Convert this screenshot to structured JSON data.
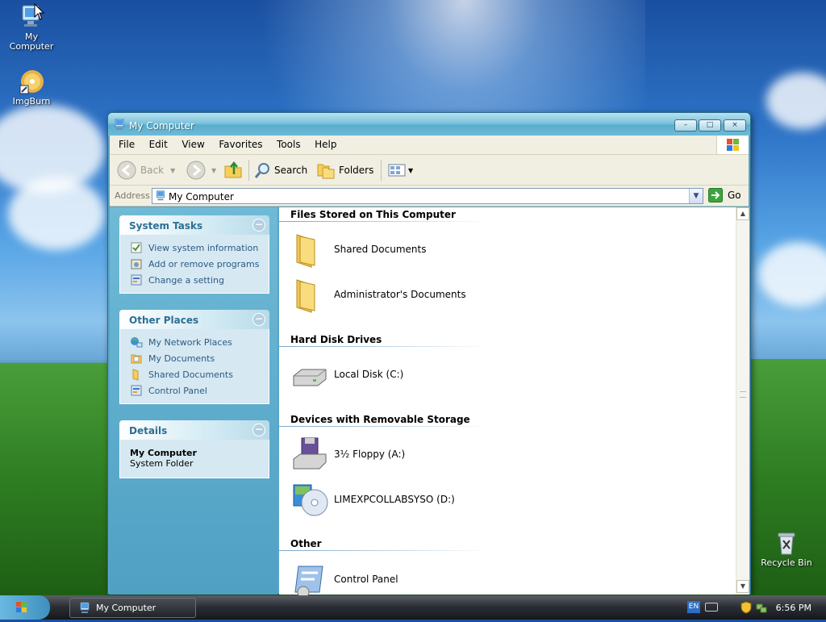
{
  "desktop": {
    "icons": [
      {
        "label": "My\nComputer"
      },
      {
        "label": "ImgBurn"
      },
      {
        "label": "Recycle Bin"
      }
    ]
  },
  "window": {
    "title": "My Computer",
    "buttons": {
      "minimize": "–",
      "maximize": "□",
      "close": "×"
    },
    "menu": [
      "File",
      "Edit",
      "View",
      "Favorites",
      "Tools",
      "Help"
    ],
    "toolbar": {
      "back": "Back",
      "search": "Search",
      "folders": "Folders"
    },
    "address": {
      "label": "Address",
      "value": "My Computer",
      "go": "Go"
    }
  },
  "left_pane": {
    "system_tasks": {
      "title": "System Tasks",
      "items": [
        "View system information",
        "Add or remove programs",
        "Change a setting"
      ]
    },
    "other_places": {
      "title": "Other Places",
      "items": [
        "My Network Places",
        "My Documents",
        "Shared Documents",
        "Control Panel"
      ]
    },
    "details": {
      "title": "Details",
      "name": "My Computer",
      "type": "System Folder"
    }
  },
  "right_pane": {
    "groups": [
      {
        "title": "Files Stored on This Computer",
        "items": [
          "Shared Documents",
          "Administrator's Documents"
        ]
      },
      {
        "title": "Hard Disk Drives",
        "items": [
          "Local Disk (C:)"
        ]
      },
      {
        "title": "Devices with Removable Storage",
        "items": [
          "3½ Floppy (A:)",
          "LIMEXPCOLLABSYSO (D:)"
        ]
      },
      {
        "title": "Other",
        "items": [
          "Control Panel"
        ]
      }
    ]
  },
  "taskbar": {
    "task_label": "My Computer",
    "language": "EN",
    "clock": "6:56 PM"
  },
  "colors": {
    "link": "#2b5b85",
    "panel_title": "#2d6e93",
    "pane_bg": "#5aa4c8",
    "menu_bg": "#f1efe2"
  }
}
